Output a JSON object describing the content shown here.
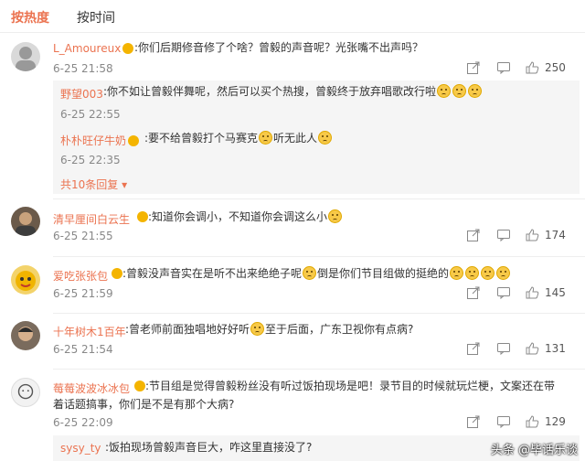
{
  "tabs": {
    "hot": "按热度",
    "time": "按时间"
  },
  "comments": [
    {
      "user": "L_Amoureux",
      "text": ":你们后期修音修了个啥？曾毅的声音呢？光张嘴不出声吗？",
      "time": "6-25 21:58",
      "likes": "250",
      "replies": [
        {
          "user": "野望003",
          "text": ":你不如让曾毅伴舞呢，然后可以买个热搜，曾毅终于放弃唱歌改行啦",
          "time": "6-25 22:55"
        },
        {
          "user": "朴朴旺仔牛奶",
          "text": ":要不给曾毅打个马赛克",
          "text2": "听无此人",
          "time": "6-25 22:35"
        }
      ],
      "more_replies": "共10条回复"
    },
    {
      "user": "清早厘间白云生",
      "text": ":知道你会调小，不知道你会调这么小",
      "time": "6-25 21:55",
      "likes": "174"
    },
    {
      "user": "爱吃张张包",
      "text": ":曾毅没声音实在是听不出来绝绝子呢",
      "text2": "倒是你们节目组做的挺绝的",
      "time": "6-25 21:59",
      "likes": "145"
    },
    {
      "user": "十年树木1百年",
      "text": ":曾老师前面独唱地好好听",
      "text2": "至于后面，广东卫视你有点病?",
      "time": "6-25 21:54",
      "likes": "131"
    },
    {
      "user": "莓莓波波冰冰包",
      "text": ":节目组是觉得曾毅粉丝没有听过饭拍现场是吧！录节目的时候就玩烂梗，文案还在带",
      "text_line2": "着话题搞事，你们是不是有那个大病?",
      "time": "6-25 22:09",
      "likes": "129"
    },
    {
      "user": "sysy_ty",
      "text": ":饭拍现场曾毅声音巨大，咋这里直接没了?"
    }
  ],
  "watermark": "头条 @毕话乐谈",
  "colors": {
    "accent": "#eb7350",
    "reply_bg": "#f5f5f5",
    "divider": "#eeeeee"
  }
}
